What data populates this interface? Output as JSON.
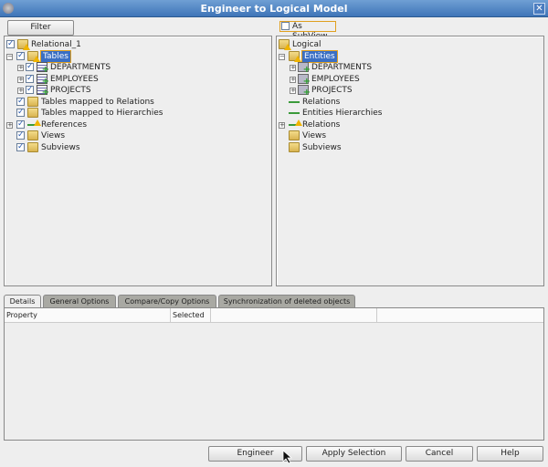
{
  "window": {
    "title": "Engineer to Logical Model",
    "close_label": "✕"
  },
  "filter_button": "Filter",
  "as_subview": {
    "label": "As SubView",
    "checked": false
  },
  "left_tree": [
    {
      "label": "Relational_1",
      "level": 0,
      "checked": true,
      "expander": "",
      "icon": "folder-warning"
    },
    {
      "label": "Tables",
      "level": 1,
      "checked": true,
      "expander": "−",
      "icon": "folder-warning",
      "selected": true
    },
    {
      "label": "DEPARTMENTS",
      "level": 2,
      "checked": true,
      "expander": "+",
      "icon": "table-add"
    },
    {
      "label": "EMPLOYEES",
      "level": 2,
      "checked": true,
      "expander": "+",
      "icon": "table-add"
    },
    {
      "label": "PROJECTS",
      "level": 2,
      "checked": true,
      "expander": "+",
      "icon": "table-add"
    },
    {
      "label": "Tables mapped to Relations",
      "level": 1,
      "checked": true,
      "expander": "",
      "icon": "folder"
    },
    {
      "label": "Tables mapped to Hierarchies",
      "level": 1,
      "checked": true,
      "expander": "",
      "icon": "folder"
    },
    {
      "label": "References",
      "level": 1,
      "checked": true,
      "expander": "+",
      "icon": "reference-warning"
    },
    {
      "label": "Views",
      "level": 1,
      "checked": true,
      "expander": "",
      "icon": "folder"
    },
    {
      "label": "Subviews",
      "level": 1,
      "checked": true,
      "expander": "",
      "icon": "subview"
    }
  ],
  "right_tree": [
    {
      "label": "Logical",
      "level": 0,
      "expander": "",
      "icon": "folder-warning"
    },
    {
      "label": "Entities",
      "level": 1,
      "expander": "−",
      "icon": "folder-warning",
      "selected": true
    },
    {
      "label": "DEPARTMENTS",
      "level": 2,
      "expander": "+",
      "icon": "entity-add"
    },
    {
      "label": "EMPLOYEES",
      "level": 2,
      "expander": "+",
      "icon": "entity-add"
    },
    {
      "label": "PROJECTS",
      "level": 2,
      "expander": "+",
      "icon": "entity-add"
    },
    {
      "label": "Relations",
      "level": 1,
      "expander": "",
      "icon": "relation"
    },
    {
      "label": "Entities Hierarchies",
      "level": 1,
      "expander": "",
      "icon": "hierarchy"
    },
    {
      "label": "Relations",
      "level": 1,
      "expander": "+",
      "icon": "reference-warning"
    },
    {
      "label": "Views",
      "level": 1,
      "expander": "",
      "icon": "folder"
    },
    {
      "label": "Subviews",
      "level": 1,
      "expander": "",
      "icon": "subview"
    }
  ],
  "tabs": [
    "Details",
    "General Options",
    "Compare/Copy Options",
    "Synchronization of deleted objects"
  ],
  "active_tab": "Details",
  "table_headers": [
    "Property",
    "Selected",
    "",
    ""
  ],
  "buttons": {
    "engineer": "Engineer",
    "apply": "Apply Selection",
    "cancel": "Cancel",
    "help": "Help"
  }
}
